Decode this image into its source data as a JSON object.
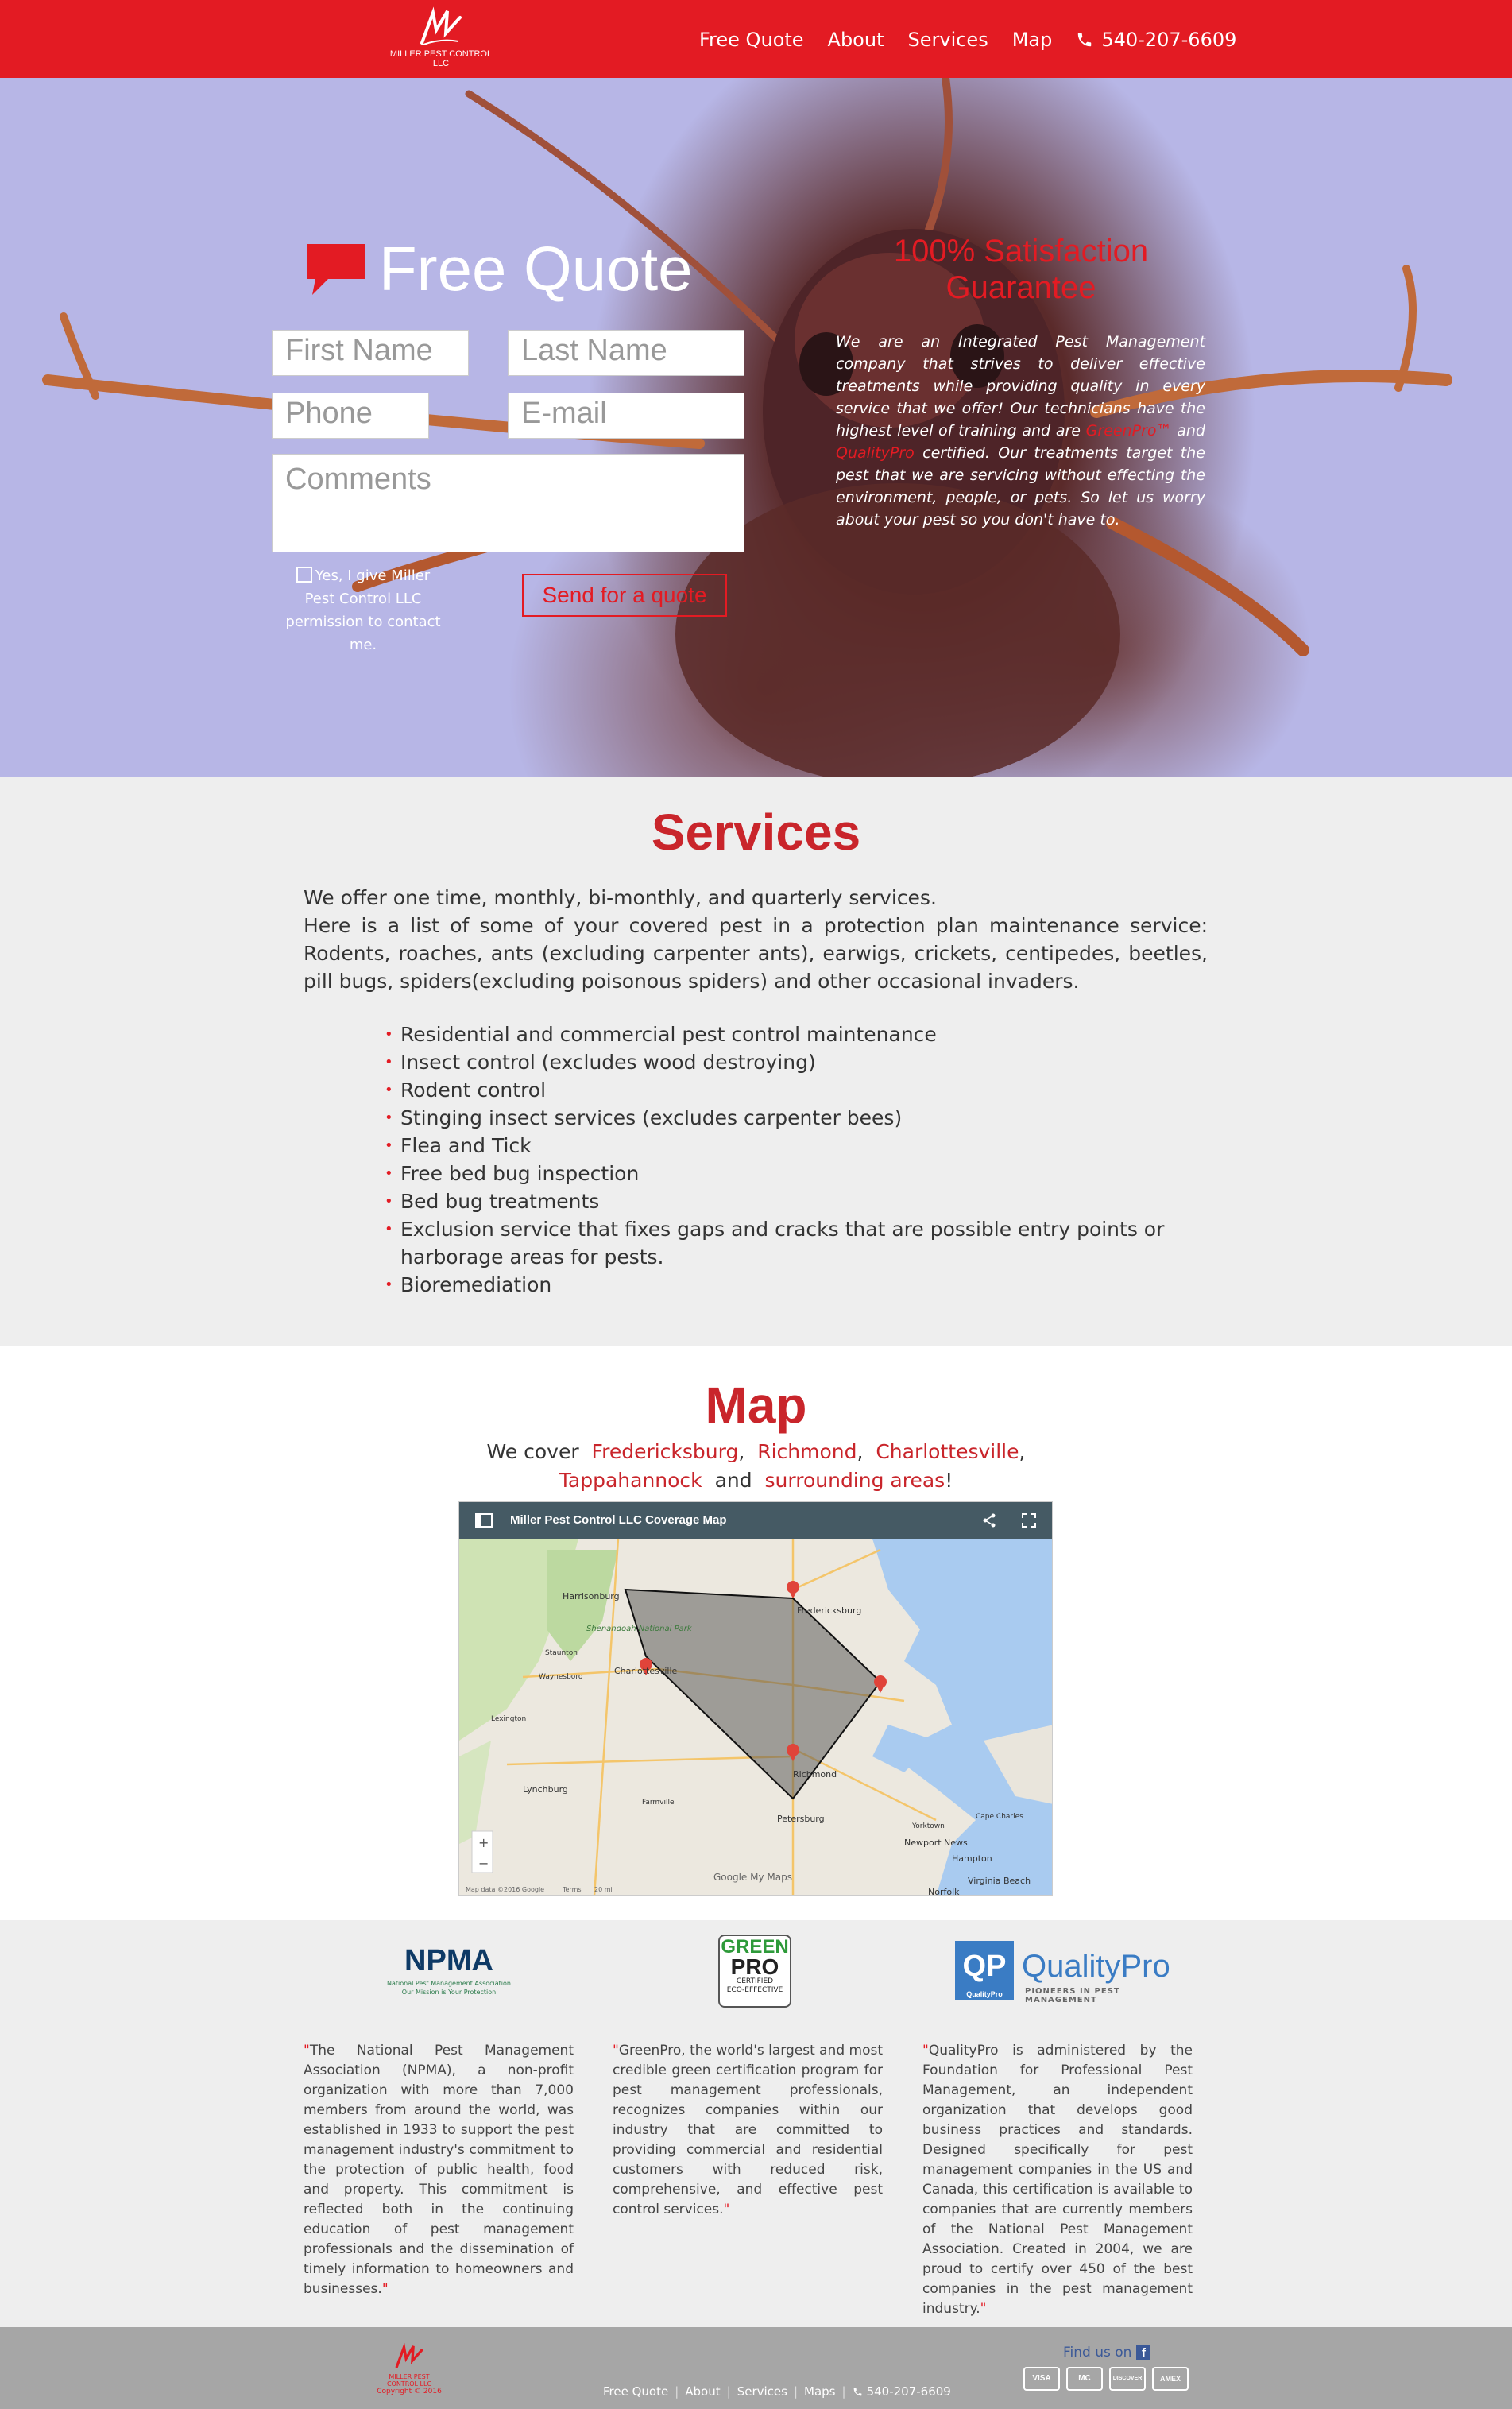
{
  "brand": {
    "logo_text": "MILLER PEST CONTROL LLC",
    "color": "#e31b23"
  },
  "nav": {
    "items": [
      "Free Quote",
      "About",
      "Services",
      "Map"
    ],
    "phone": "540-207-6609"
  },
  "quote_form": {
    "title": "Free Quote",
    "first_name_placeholder": "First Name",
    "last_name_placeholder": "Last Name",
    "phone_placeholder": "Phone",
    "email_placeholder": "E-mail",
    "comments_placeholder": "Comments",
    "consent_label": "Yes, I give Miller Pest Control LLC permission to contact me.",
    "submit_label": "Send for a quote"
  },
  "guarantee": {
    "title": "100% Satisfaction Guarantee",
    "text_before": "We are an Integrated Pest Management company that strives to deliver effective treatments while providing quality in every service that we offer! Our technicians have the highest level of training and are ",
    "greenpro": "GreenPro™",
    "text_and": " and ",
    "qualitypro": "QualityPro",
    "text_after": " certified. Our treatments target the pest that we are servicing without effecting the environment, people, or pets. So let us worry about your pest so you don't have to."
  },
  "services": {
    "title": "Services",
    "intro_1": "We offer one time, monthly, bi-monthly, and quarterly services.",
    "intro_2": "Here is a list of some of your covered pest in a protection plan maintenance service: Rodents, roaches, ants (excluding carpenter ants), earwigs, crickets, centipedes, beetles, pill bugs, spiders(excluding poisonous spiders) and other occasional invaders.",
    "list": [
      "Residential and commercial pest control maintenance",
      "Insect control (excludes wood destroying)",
      "Rodent control",
      "Stinging insect services (excludes carpenter bees)",
      "Flea and Tick",
      "Free bed bug inspection",
      "Bed bug treatments",
      "Exclusion service that fixes gaps and cracks that are possible entry points or harborage areas for pests.",
      "Bioremediation"
    ]
  },
  "map": {
    "title": "Map",
    "we_cover": "We cover",
    "cities": [
      "Fredericksburg",
      "Richmond",
      "Charlottesville",
      "Tappahannock"
    ],
    "and": "and",
    "surrounding": "surrounding areas",
    "embed_title": "Miller Pest Control LLC Coverage Map",
    "labels": {
      "harrisonburg": "Harrisonburg",
      "fredericksburg": "Fredericksburg",
      "charlottesville": "Charlottesville",
      "richmond": "Richmond",
      "lynchburg": "Lynchburg",
      "petersburg": "Petersburg",
      "newport_news": "Newport News",
      "hampton": "Hampton",
      "virginia_beach": "Virginia Beach",
      "norfolk": "Norfolk",
      "shenandoah": "Shenandoah National Park",
      "staunton": "Staunton",
      "waynesboro": "Waynesboro",
      "lexington": "Lexington",
      "farmville": "Farmville",
      "yorktown": "Yorktown",
      "cape_charles": "Cape Charles",
      "google": "Google My Maps",
      "attribution": "Map data ©2016 Google",
      "terms": "Terms",
      "scale": "20 mi",
      "zoom_in": "+",
      "zoom_out": "−"
    }
  },
  "associations": {
    "npma_logo": "NPMA",
    "npma_sub_1": "National Pest Management Association",
    "npma_sub_2": "Our Mission is Your Protection",
    "npma_text": "The National Pest Management Association (NPMA), a non-profit organization with more than 7,000 members from around the world, was established in 1933 to support the pest management industry's commitment to the protection of public health, food and property. This commitment is reflected both in the continuing education of pest management professionals and the dissemination of timely information to homeowners and businesses.",
    "greenpro_logo_1": "GREEN",
    "greenpro_logo_2": "PRO",
    "greenpro_logo_3": "CERTIFIED",
    "greenpro_logo_4": "ECO-EFFECTIVE",
    "greenpro_text": "GreenPro, the world's largest and most credible green certification program for pest management professionals, recognizes companies within our industry that are committed to providing commercial and residential customers with reduced risk, comprehensive, and effective pest control services.",
    "qp_box": "QP",
    "qp_box_sub": "QualityPro",
    "qp_name": "QualityPro",
    "qp_tag": "PIONEERS IN PEST MANAGEMENT",
    "qp_text": "QualityPro is administered by the Foundation for Professional Pest Management, an independent organization that develops good business practices and standards. Designed specifically for pest management companies in the US and Canada, this certification is available to companies that are currently members of the National Pest Management Association. Created in 2004, we are proud to certify over 450 of the best companies in the pest management industry.",
    "quote_mark": "\""
  },
  "footer": {
    "logo_text": "MILLER PEST CONTROL LLC",
    "copyright": "Copyright © 2016",
    "links": [
      "Free Quote",
      "About",
      "Services",
      "Maps"
    ],
    "phone": "540-207-6609",
    "find_us": "Find us on",
    "fb": "f",
    "cards": [
      "VISA",
      "MC",
      "DISCOVER",
      "AMEX"
    ]
  }
}
